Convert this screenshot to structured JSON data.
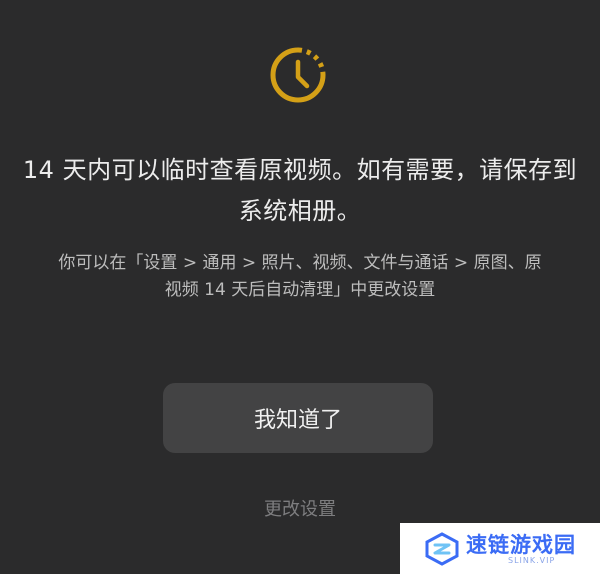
{
  "header": {
    "icon": "clock-icon",
    "accent_color": "#d4a017"
  },
  "main": {
    "headline_line1": "14 天内可以临时查看原视频。如有需要，请保存到",
    "headline_line2": "系统相册。",
    "description_line1": "你可以在「设置 > 通用 > 照片、视频、文件与通话 > 原图、原",
    "description_line2": "视频 14 天后自动清理」中更改设置"
  },
  "actions": {
    "primary_label": "我知道了",
    "secondary_label": "更改设置"
  },
  "watermark": {
    "text": "速链游戏园",
    "subtext": "SLINK.VIP",
    "color": "#3b6cf5"
  }
}
